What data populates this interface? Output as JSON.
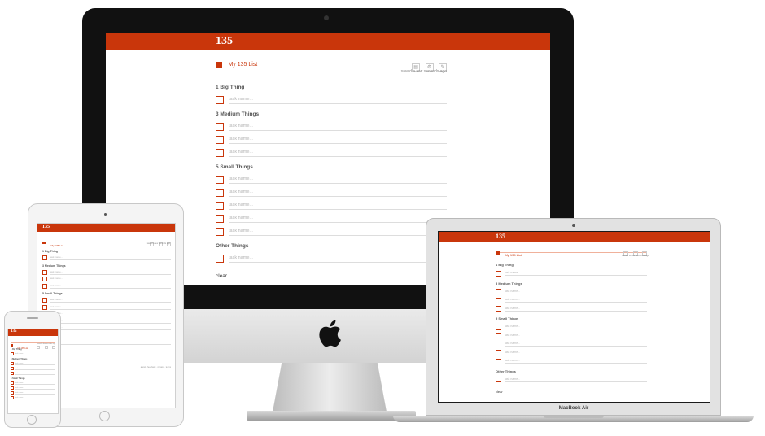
{
  "app": {
    "logo": "135",
    "list_title": "My 135 List",
    "saved_status": "saved a few seconds ago",
    "tool_icons": [
      "print-icon",
      "settings-icon",
      "edit-icon"
    ],
    "sections": [
      {
        "title": "1 Big Thing",
        "placeholders": [
          "task name..."
        ]
      },
      {
        "title": "3 Medium Things",
        "placeholders": [
          "task name...",
          "task name...",
          "task name..."
        ]
      },
      {
        "title": "5 Small Things",
        "placeholders": [
          "task name...",
          "task name...",
          "task name...",
          "task name...",
          "task name..."
        ]
      },
      {
        "title": "Other Things",
        "placeholders": [
          "task name..."
        ]
      }
    ],
    "clear_label": "clear",
    "accent_color": "#c9360b"
  },
  "devices": {
    "macbook_label": "MacBook Air",
    "ipad_footer": "about · feedback · privacy · terms"
  }
}
